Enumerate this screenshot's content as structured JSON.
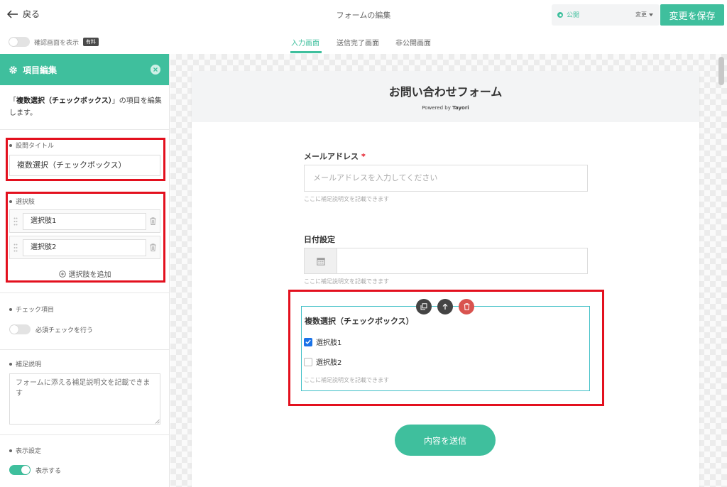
{
  "header": {
    "back_label": "戻る",
    "page_title": "フォームの編集",
    "status_label": "公開",
    "status_change_label": "変更",
    "save_label": "変更を保存",
    "confirm_screen_label": "確認画面を表示",
    "paid_badge": "有料"
  },
  "tabs": [
    {
      "label": "入力画面",
      "active": true
    },
    {
      "label": "送信完了画面",
      "active": false
    },
    {
      "label": "非公開画面",
      "active": false
    }
  ],
  "sidebar": {
    "header_title": "項目編集",
    "desc_prefix": "「",
    "desc_item": "複数選択（チェックボックス）",
    "desc_suffix": "」の項目を編集します。",
    "question_title_label": "設問タイトル",
    "question_title_value": "複数選択（チェックボックス）",
    "choices_label": "選択肢",
    "choices": [
      "選択肢1",
      "選択肢2"
    ],
    "add_choice_label": "選択肢を追加",
    "check_label": "チェック項目",
    "required_check_label": "必須チェックを行う",
    "required_check_on": false,
    "note_label": "補足説明",
    "note_placeholder": "フォームに添える補足説明文を記載できます",
    "display_label": "表示設定",
    "display_toggle_label": "表示する",
    "display_on": true
  },
  "form": {
    "title": "お問い合わせフォーム",
    "powered_by": "Powered by",
    "powered_brand": "Tayori",
    "email_label": "メールアドレス",
    "required_mark": "*",
    "email_placeholder": "メールアドレスを入力してください",
    "help_text": "ここに補足説明文を記載できます",
    "date_label": "日付設定",
    "checkbox_title": "複数選択（チェックボックス）",
    "checkbox_options": [
      {
        "label": "選択肢1",
        "checked": true
      },
      {
        "label": "選択肢2",
        "checked": false
      }
    ],
    "submit_label": "内容を送信"
  },
  "colors": {
    "accent": "#3fbf9d",
    "highlight": "#e3101e",
    "checkbox": "#1a73e8"
  }
}
